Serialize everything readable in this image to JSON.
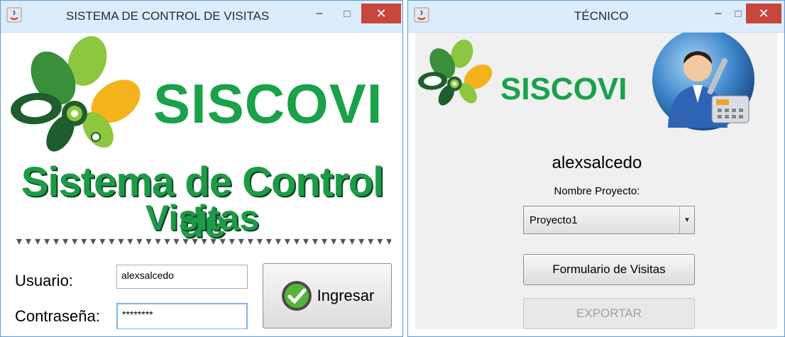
{
  "login_window": {
    "title": "SISTEMA DE CONTROL DE VISITAS",
    "brand": "SISCOVI",
    "subtitle_line1": "Sistema de Control de",
    "subtitle_line2": "Visitas",
    "usuario_label": "Usuario:",
    "usuario_value": "alexsalcedo",
    "contrasena_label": "Contraseña:",
    "contrasena_value": "********",
    "ingresar_label": "Ingresar"
  },
  "tecnico_window": {
    "title": "TÉCNICO",
    "brand": "SISCOVI",
    "username": "alexsalcedo",
    "nombre_proyecto_label": "Nombre Proyecto:",
    "proyecto_selected": "Proyecto1",
    "formulario_label": "Formulario de Visitas",
    "exportar_label": "EXPORTAR"
  },
  "titlebar_buttons": {
    "minimize": "−",
    "maximize": "□",
    "close": "✕"
  },
  "icons": [
    "java-app-icon",
    "leaf-logo-icon",
    "checkmark-icon",
    "technician-icon"
  ],
  "colors": {
    "brand_green": "#1aa14a",
    "titlebar": "#dcecfc",
    "close_red": "#c9463d"
  }
}
